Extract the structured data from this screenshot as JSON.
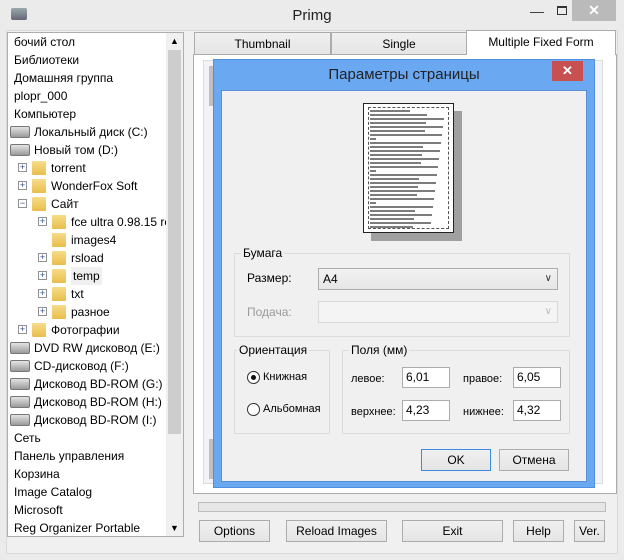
{
  "window": {
    "title": "Primg",
    "app_icon": "printer-icon"
  },
  "tree": {
    "items": [
      {
        "label": "бочий стол",
        "level": 0,
        "icon": "none"
      },
      {
        "label": "Библиотеки",
        "level": 0,
        "icon": "none"
      },
      {
        "label": "Домашняя группа",
        "level": 0,
        "icon": "none"
      },
      {
        "label": "plopr_000",
        "level": 0,
        "icon": "none"
      },
      {
        "label": "Компьютер",
        "level": 0,
        "icon": "none"
      },
      {
        "label": "Локальный диск (C:)",
        "level": 1,
        "icon": "drive"
      },
      {
        "label": "Новый том (D:)",
        "level": 1,
        "icon": "drive"
      },
      {
        "label": "torrent",
        "level": 2,
        "icon": "folder",
        "expander": "+"
      },
      {
        "label": "WonderFox Soft",
        "level": 2,
        "icon": "folder",
        "expander": "+"
      },
      {
        "label": "Сайт",
        "level": 2,
        "icon": "folder",
        "expander": "-"
      },
      {
        "label": "fce ultra 0.98.15 re",
        "level": 3,
        "icon": "folder",
        "expander": "+"
      },
      {
        "label": "images4",
        "level": 3,
        "icon": "folder",
        "expander": ""
      },
      {
        "label": "rsload",
        "level": 3,
        "icon": "folder",
        "expander": "+"
      },
      {
        "label": "temp",
        "level": 3,
        "icon": "folder",
        "expander": "+",
        "selected": true
      },
      {
        "label": "txt",
        "level": 3,
        "icon": "folder",
        "expander": "+"
      },
      {
        "label": "разное",
        "level": 3,
        "icon": "folder",
        "expander": "+"
      },
      {
        "label": "Фотографии",
        "level": 2,
        "icon": "folder",
        "expander": "+"
      },
      {
        "label": "DVD RW дисковод (E:)",
        "level": 1,
        "icon": "drive"
      },
      {
        "label": "CD-дисковод (F:)",
        "level": 1,
        "icon": "drive"
      },
      {
        "label": "Дисковод BD-ROM (G:)",
        "level": 1,
        "icon": "drive"
      },
      {
        "label": "Дисковод BD-ROM (H:)",
        "level": 1,
        "icon": "drive"
      },
      {
        "label": "Дисковод BD-ROM (I:)",
        "level": 1,
        "icon": "drive"
      },
      {
        "label": "Сеть",
        "level": 0,
        "icon": "none"
      },
      {
        "label": "Панель управления",
        "level": 0,
        "icon": "none"
      },
      {
        "label": "Корзина",
        "level": 0,
        "icon": "none"
      },
      {
        "label": "Image Catalog",
        "level": 0,
        "icon": "none"
      },
      {
        "label": "Microsoft",
        "level": 0,
        "icon": "none"
      },
      {
        "label": "Reg Organizer Portable",
        "level": 0,
        "icon": "none"
      }
    ]
  },
  "tabs": [
    {
      "label": "Thumbnail"
    },
    {
      "label": "Single"
    },
    {
      "label": "Multiple Fixed Form",
      "selected": true
    }
  ],
  "dialog": {
    "title": "Параметры страницы",
    "paper_group": "Бумага",
    "size_label": "Размер:",
    "size_value": "A4",
    "source_label": "Подача:",
    "source_value": "",
    "orientation_group": "Ориентация",
    "portrait": "Книжная",
    "landscape": "Альбомная",
    "orientation_selected": "portrait",
    "margins_group": "Поля (мм)",
    "left_label": "левое:",
    "left_value": "6,01",
    "right_label": "правое:",
    "right_value": "6,05",
    "top_label": "верхнее:",
    "top_value": "4,23",
    "bottom_label": "нижнее:",
    "bottom_value": "4,32",
    "ok": "OK",
    "cancel": "Отмена"
  },
  "buttons": {
    "options": "Options",
    "reload": "Reload Images",
    "exit": "Exit",
    "help": "Help",
    "ver": "Ver."
  },
  "colors": {
    "dialog_frame": "#6aa8f2",
    "dialog_close": "#c75050"
  }
}
